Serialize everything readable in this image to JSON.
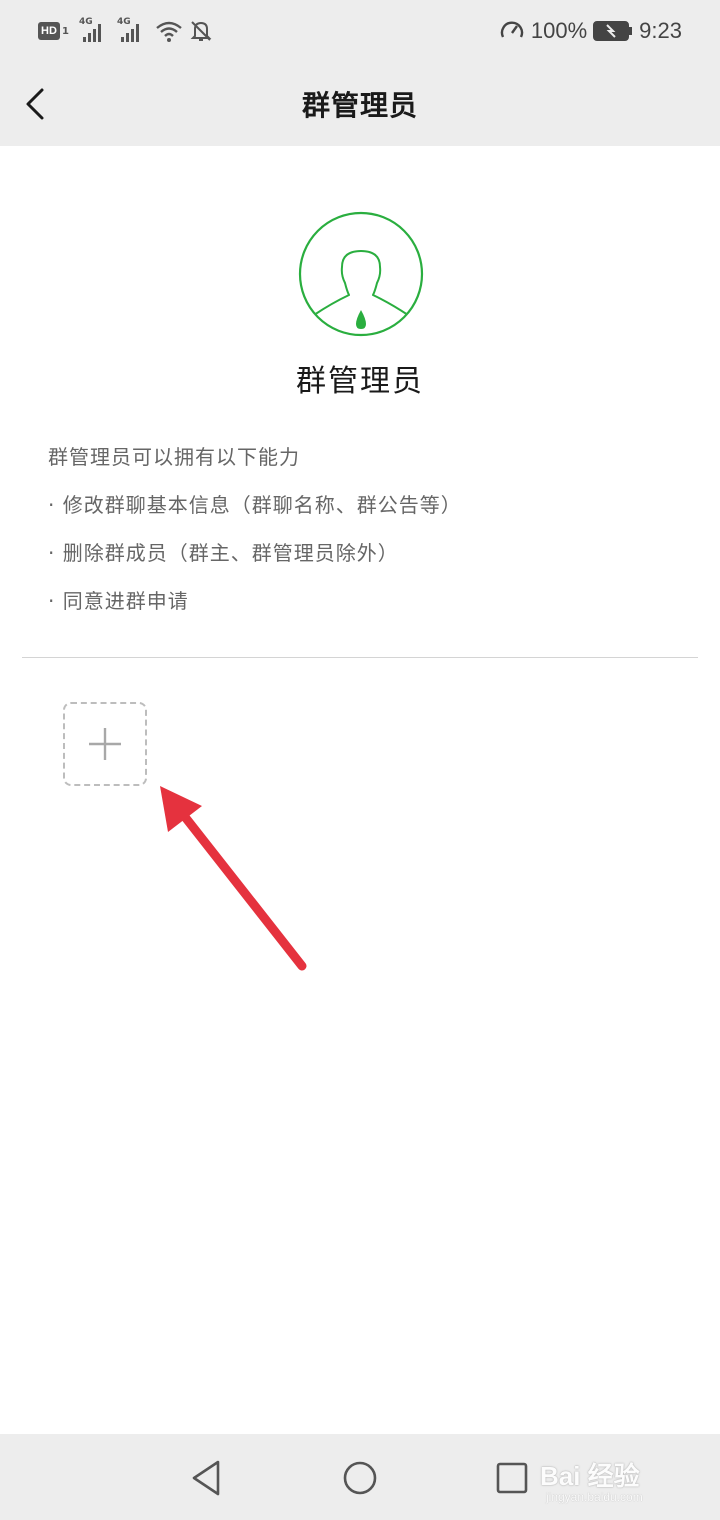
{
  "status_bar": {
    "hd": "HD",
    "sim": "1",
    "net1": "4G",
    "net2": "4G",
    "battery_percent": "100%",
    "time": "9:23"
  },
  "header": {
    "title": "群管理员"
  },
  "role": {
    "name": "群管理员"
  },
  "description": {
    "lines": [
      "群管理员可以拥有以下能力",
      "· 修改群聊基本信息（群聊名称、群公告等）",
      "· 删除群成员（群主、群管理员除外）",
      "· 同意进群申请"
    ]
  },
  "colors": {
    "accent_green": "#2aae3f",
    "annotation_red": "#e5323e",
    "bar_bg": "#ededed"
  },
  "watermark": {
    "text": "Bai 经验",
    "sub": "jingyan.baidu.com"
  }
}
